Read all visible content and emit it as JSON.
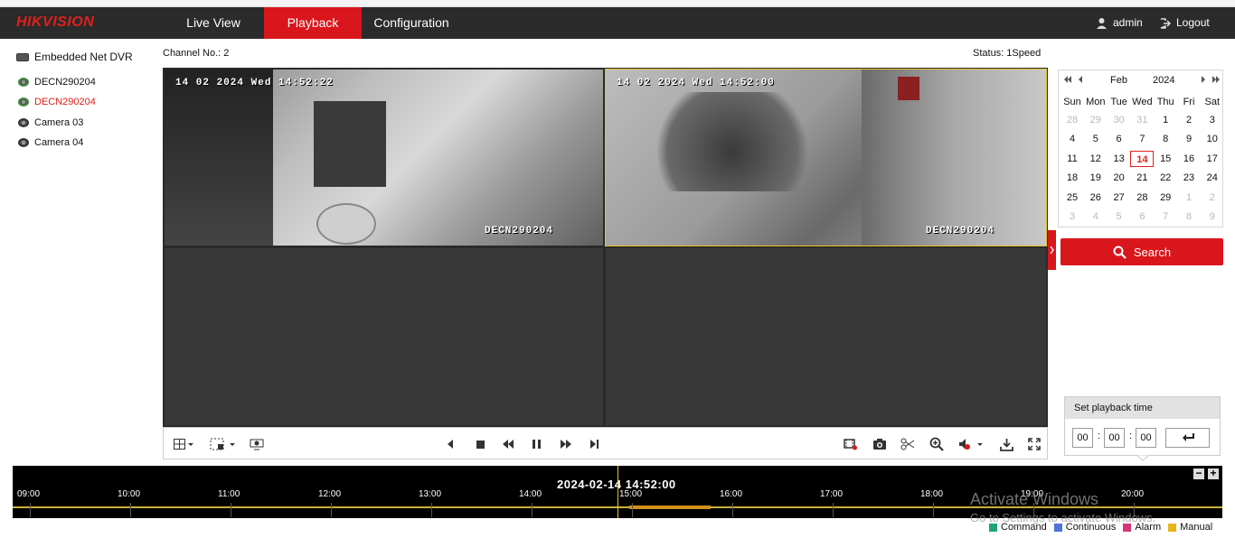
{
  "brand": "HIKVISION",
  "nav": {
    "tabs": [
      "Live View",
      "Playback",
      "Configuration"
    ],
    "active": "Playback"
  },
  "user": {
    "name": "admin",
    "logout": "Logout"
  },
  "tree": {
    "root": "Embedded Net DVR",
    "items": [
      "DECN290204",
      "DECN290204",
      "Camera 03",
      "Camera 04"
    ],
    "selected_index": 1
  },
  "channel": "Channel No.: 2",
  "status": "Status: 1Speed",
  "videos": [
    {
      "osd_time": "14 02 2024 Wed 14:52:22",
      "osd_name": "DECN290204"
    },
    {
      "osd_time": "14 02 2024 Wed 14:52:00",
      "osd_name": "DECN290204"
    }
  ],
  "calendar": {
    "month": "Feb",
    "year": "2024",
    "dow": [
      "Sun",
      "Mon",
      "Tue",
      "Wed",
      "Thu",
      "Fri",
      "Sat"
    ],
    "weeks": [
      [
        "28",
        "29",
        "30",
        "31",
        "1",
        "2",
        "3"
      ],
      [
        "4",
        "5",
        "6",
        "7",
        "8",
        "9",
        "10"
      ],
      [
        "11",
        "12",
        "13",
        "14",
        "15",
        "16",
        "17"
      ],
      [
        "18",
        "19",
        "20",
        "21",
        "22",
        "23",
        "24"
      ],
      [
        "25",
        "26",
        "27",
        "28",
        "29",
        "1",
        "2"
      ],
      [
        "3",
        "4",
        "5",
        "6",
        "7",
        "8",
        "9"
      ]
    ],
    "today": "14"
  },
  "search_label": "Search",
  "playback_time": {
    "title": "Set playback time",
    "h": "00",
    "m": "00",
    "s": "00"
  },
  "timeline": {
    "current": "2024-02-14 14:52:00",
    "labels": [
      "09:00",
      "10:00",
      "11:00",
      "12:00",
      "13:00",
      "14:00",
      "15:00",
      "16:00",
      "17:00",
      "18:00",
      "19:00",
      "20:00"
    ]
  },
  "legend": [
    {
      "label": "Command",
      "color": "#1fa37a"
    },
    {
      "label": "Continuous",
      "color": "#4f73d8"
    },
    {
      "label": "Alarm",
      "color": "#d8357a"
    },
    {
      "label": "Manual",
      "color": "#e8b61c"
    }
  ],
  "watermark": {
    "line1": "Activate Windows",
    "line2": "Go to Settings to activate Windows."
  }
}
